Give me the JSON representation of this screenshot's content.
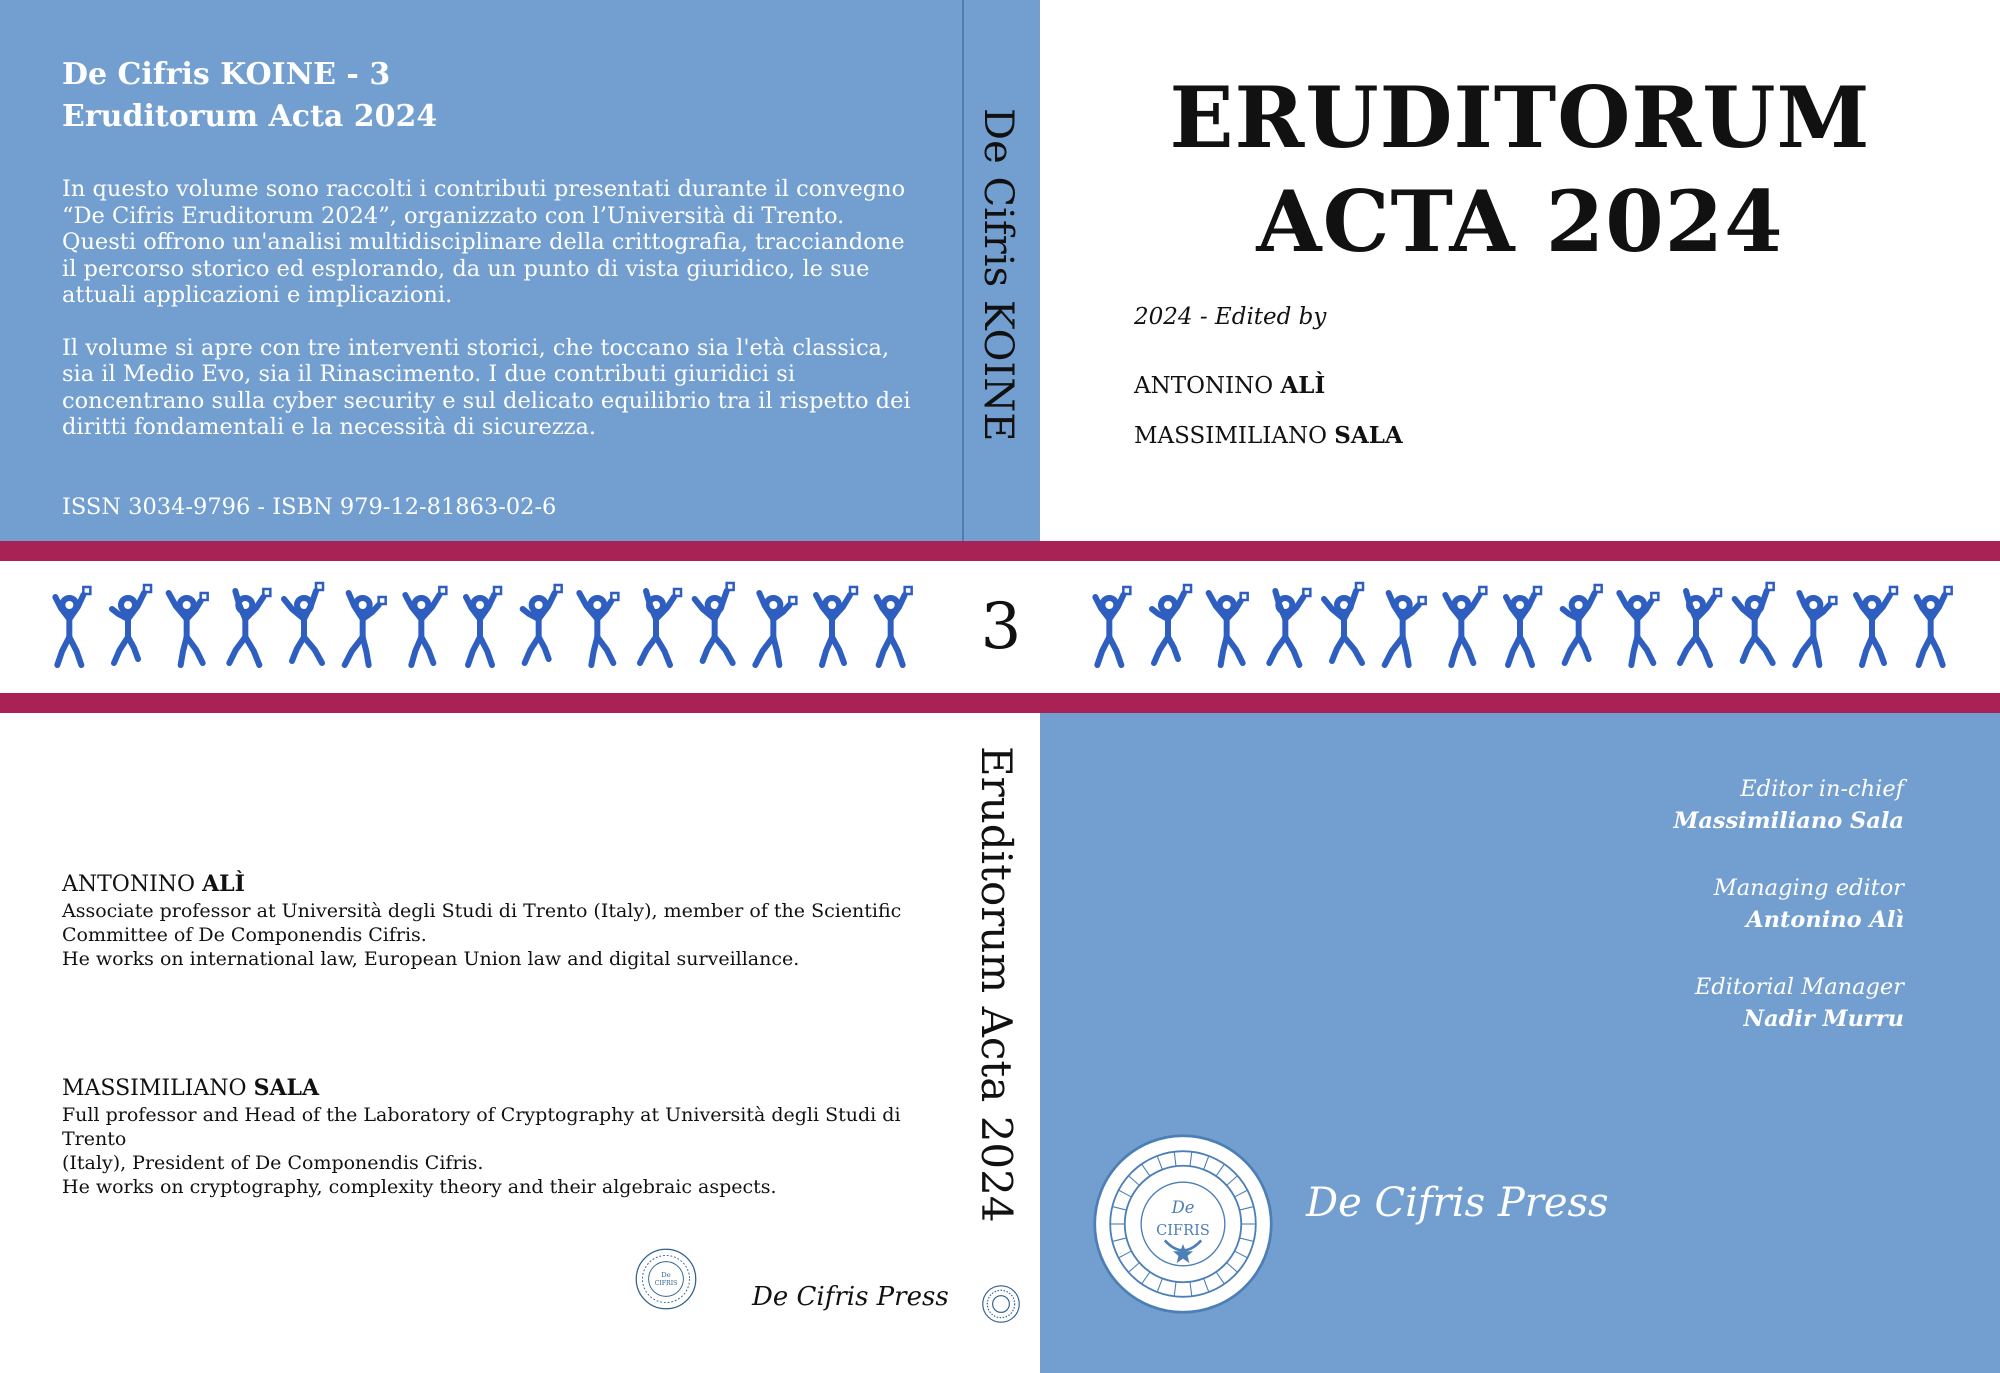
{
  "back": {
    "series_line1": "De Cifris KOINE - 3",
    "series_line2": "Eruditorum Acta 2024",
    "desc_p1": "In questo volume sono raccolti i contributi presentati durante il convegno “De Cifris Eruditorum 2024”, organizzato con l’Università di Trento. Questi offrono un'analisi multidisciplinare della crittografia, tracciandone il percorso storico ed esplorando, da un punto di vista giuridico, le sue attuali applicazioni e implicazioni.",
    "desc_p2": "Il volume si apre con tre interventi storici, che toccano sia l'età classica, sia il Medio Evo, sia il Rinascimento. I due contributi giuridici si concentrano sulla cyber security e sul delicato equilibrio tra il rispetto dei diritti fondamentali e la necessità di sicurezza.",
    "isbn": "ISSN 3034-9796 - ISBN 979-12-81863-02-6"
  },
  "spine": {
    "series": "De Cifris KOINE",
    "number": "3",
    "title": "Eruditorum Acta 2024"
  },
  "front": {
    "title_line1": "ERUDITORUM",
    "title_line2": "ACTA 2024",
    "edited_by": "2024 - Edited by",
    "editor1_first": "ANTONINO",
    "editor1_last": "ALÌ",
    "editor2_first": "MASSIMILIANO",
    "editor2_last": "SALA"
  },
  "bios": [
    {
      "first": "ANTONINO",
      "last": "ALÌ",
      "line1": "Associate professor at Università degli Studi di Trento (Italy), member of the Scientific",
      "line2": "Committee of De Componendis Cifris.",
      "line3": "He works on international law, European Union law and digital surveillance."
    },
    {
      "first": "MASSIMILIANO",
      "last": "SALA",
      "line1": "Full professor and Head of the Laboratory of Cryptography at Università degli Studi di Trento",
      "line2": "(Italy), President of De Componendis Cifris.",
      "line3": "He works on cryptography, complexity theory and their algebraic aspects."
    }
  ],
  "masthead": [
    {
      "role": "Editor in-chief",
      "name": "Massimiliano Sala"
    },
    {
      "role": "Managing editor",
      "name": "Antonino Alì"
    },
    {
      "role": "Editorial Manager",
      "name": "Nadir Murru"
    }
  ],
  "press": {
    "name": "De Cifris Press",
    "logo_text_top": "De",
    "logo_text_bottom": "CIFRIS"
  },
  "colors": {
    "cover_blue": "#739fd0",
    "stripe_magenta": "#a82255",
    "dancer_blue": "#2e5fc0"
  },
  "icons": [
    "dancing-men-frieze-icon",
    "de-cifris-seal-icon"
  ]
}
